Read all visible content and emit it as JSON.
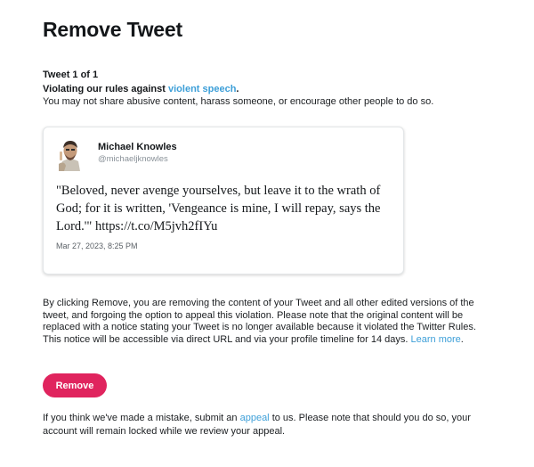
{
  "page": {
    "title": "Remove Tweet",
    "counter": "Tweet 1 of 1"
  },
  "violation": {
    "prefix": "Violating our rules against ",
    "rule_link": "violent speech",
    "suffix": ".",
    "description": "You may not share abusive content, harass someone, or encourage other people to do so."
  },
  "tweet": {
    "author_name": "Michael Knowles",
    "author_handle": "@michaeljknowles",
    "text": "\"Beloved, never avenge yourselves, but leave it to the wrath of God; for it is written, 'Vengeance is mine, I will repay, says the Lord.'\" https://t.co/M5jvh2fIYu",
    "date": "Mar 27, 2023, 8:25 PM"
  },
  "notice": {
    "text": "By clicking Remove, you are removing the content of your Tweet and all other edited versions of the tweet, and forgoing the option to appeal this violation. Please note that the original content will be replaced with a notice stating your Tweet is no longer available because it violated the Twitter Rules. This notice will be accessible via direct URL and via your profile timeline for 14 days. ",
    "learn_more": "Learn more",
    "learn_more_suffix": "."
  },
  "actions": {
    "remove_label": "Remove"
  },
  "appeal": {
    "prefix": "If you think we've made a mistake, submit an ",
    "link": "appeal",
    "suffix": " to us. Please note that should you do so, your account will remain locked while we review your appeal."
  },
  "colors": {
    "accent_link": "#3d9fd8",
    "remove_button": "#e0245e",
    "text": "#14171a"
  },
  "icons": {
    "avatar": "avatar-photo"
  }
}
